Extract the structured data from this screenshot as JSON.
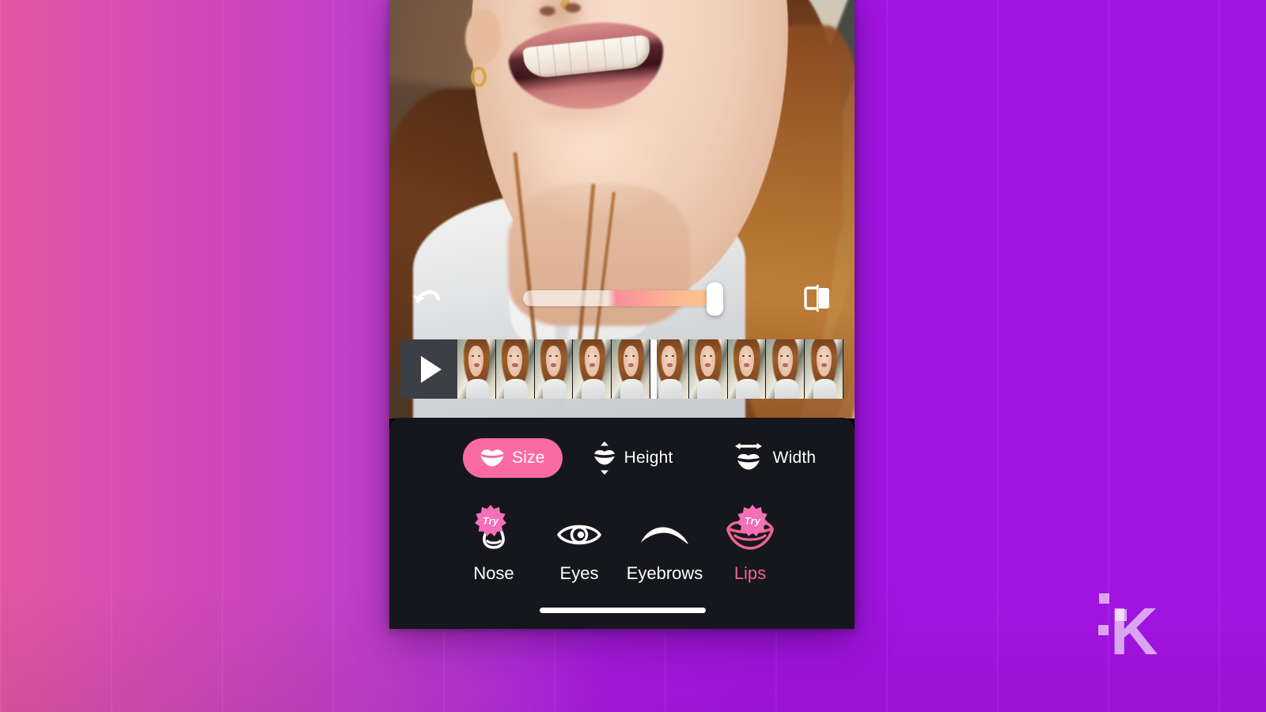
{
  "app": {
    "kind": "mobile-video-face-editor",
    "screen_name": "Lips editor"
  },
  "background": {
    "gradient_from": "#e0569f",
    "gradient_to": "#a314e3"
  },
  "preview": {
    "description": "Close-up selfie video of a smiling woman with long reddish-brown hair wearing a white blouse, brick wall and stair railing in background"
  },
  "controls": {
    "undo_icon": "undo-arrow-icon",
    "compare_icon": "before-after-compare-icon",
    "slider": {
      "name": "intensity-slider",
      "value_percent": 95,
      "track_gradient_start": "#ffffff",
      "track_gradient_mid": "#f98e9d",
      "track_gradient_end": "#fbc58f",
      "thumb_color": "#ffffff"
    }
  },
  "timeline": {
    "play_icon": "play-icon",
    "playhead_position_percent": 50,
    "frame_count": 10
  },
  "tabs": [
    {
      "id": "size",
      "label": "Size",
      "icon": "lips-icon",
      "active": true
    },
    {
      "id": "height",
      "label": "Height",
      "icon": "lips-height-icon",
      "active": false
    },
    {
      "id": "width",
      "label": "Width",
      "icon": "lips-width-icon",
      "active": false
    }
  ],
  "tab_active_color": "#fa6ba5",
  "features": [
    {
      "id": "nose",
      "label": "Nose",
      "icon": "nose-icon",
      "badge": "Try",
      "active": false
    },
    {
      "id": "eyes",
      "label": "Eyes",
      "icon": "eye-icon",
      "badge": null,
      "active": false
    },
    {
      "id": "eyebrows",
      "label": "Eyebrows",
      "icon": "eyebrow-icon",
      "badge": null,
      "active": false
    },
    {
      "id": "lips",
      "label": "Lips",
      "icon": "lips-icon",
      "badge": "Try",
      "active": true
    }
  ],
  "feature_active_color": "#f0648f",
  "badge_color": "#f670b8",
  "system": {
    "home_indicator": true
  },
  "watermark": {
    "letter": "K"
  }
}
